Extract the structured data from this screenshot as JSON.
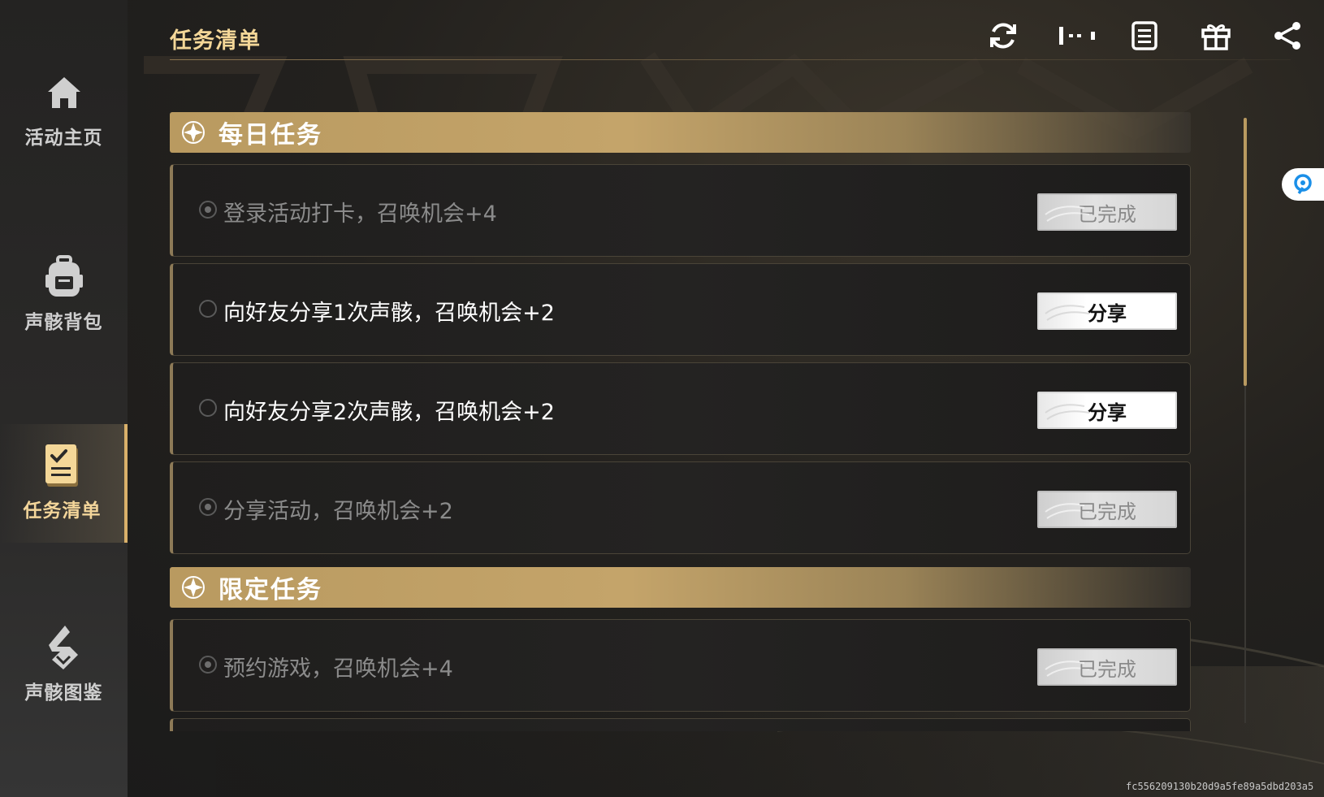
{
  "topbar": {
    "title": "任务清单",
    "icons": [
      "refresh-icon",
      "more-dots-icon",
      "list-icon",
      "gift-icon",
      "share-icon"
    ]
  },
  "sidebar": {
    "items": [
      {
        "label": "活动主页",
        "icon": "home-icon",
        "active": false
      },
      {
        "label": "声骸背包",
        "icon": "backpack-icon",
        "active": false
      },
      {
        "label": "任务清单",
        "icon": "task-list-icon",
        "active": true
      },
      {
        "label": "声骸图鉴",
        "icon": "codex-icon",
        "active": false
      }
    ]
  },
  "sections": [
    {
      "title": "每日任务",
      "tasks": [
        {
          "text": "登录活动打卡，召唤机会+4",
          "button": "已完成",
          "status": "completed"
        },
        {
          "text": "向好友分享1次声骸，召唤机会+2",
          "button": "分享",
          "status": "pending"
        },
        {
          "text": "向好友分享2次声骸，召唤机会+2",
          "button": "分享",
          "status": "pending"
        },
        {
          "text": "分享活动，召唤机会+2",
          "button": "已完成",
          "status": "completed"
        }
      ]
    },
    {
      "title": "限定任务",
      "tasks": [
        {
          "text": "预约游戏，召唤机会+4",
          "button": "已完成",
          "status": "completed"
        }
      ]
    }
  ],
  "footer": {
    "hash": "fc556209130b20d9a5fe89a5dbd203a5"
  },
  "colors": {
    "accent_gold": "#f4d798",
    "section_gold": "#c4a46a",
    "float_widget_icon": "#1a8fe8"
  }
}
